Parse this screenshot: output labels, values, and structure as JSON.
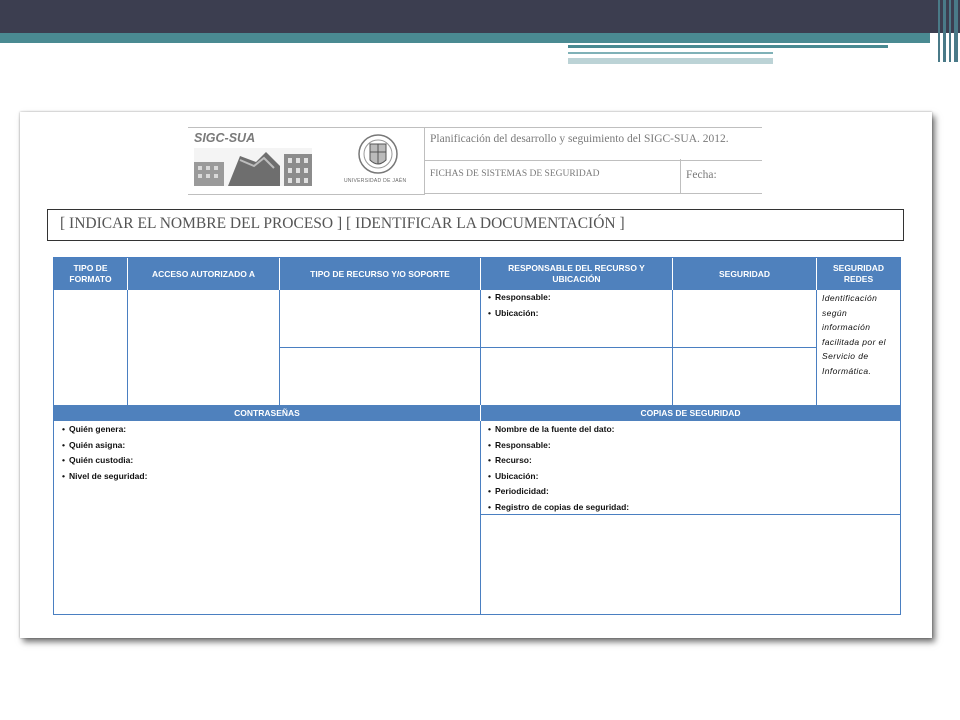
{
  "document": {
    "logo_text": "SIGC-SUA",
    "university_text": "UNIVERSIDAD DE JAÉN",
    "title": "Planificación del desarrollo y seguimiento del SIGC-SUA. 2012.",
    "subtitle": "FICHAS DE SISTEMAS DE SEGURIDAD",
    "date_label": "Fecha:",
    "process_line": "[ INDICAR EL NOMBRE DEL PROCESO ]   [ IDENTIFICAR LA DOCUMENTACIÓN ]"
  },
  "table": {
    "headers": {
      "tipo_formato": "TIPO DE FORMATO",
      "acceso": "ACCESO AUTORIZADO A",
      "tipo_recurso": "TIPO DE RECURSO Y/O SOPORTE",
      "responsable": "RESPONSABLE DEL RECURSO Y UBICACIÓN",
      "seguridad": "SEGURIDAD",
      "seguridad_redes": "SEGURIDAD REDES"
    },
    "responsable_items": [
      "Responsable:",
      "Ubicación:"
    ],
    "redes_note": "Identificación según información facilitada por el Servicio de Informática.",
    "contrasenas_header": "CONTRASEÑAS",
    "contrasenas_items": [
      "Quién genera:",
      "Quién asigna:",
      "Quién custodia:",
      "Nivel de seguridad:"
    ],
    "copias_header": "COPIAS DE SEGURIDAD",
    "copias_items": [
      "Nombre de la fuente del dato:",
      "Responsable:",
      "Recurso:",
      "Ubicación:",
      "Periodicidad:",
      "Registro de copias de seguridad:"
    ]
  }
}
